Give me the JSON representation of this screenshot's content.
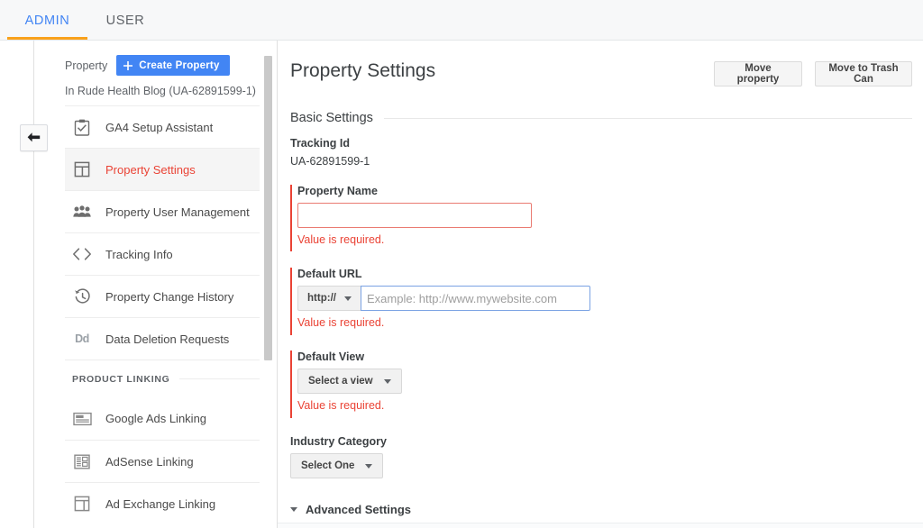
{
  "tabs": [
    {
      "label": "ADMIN",
      "active": true
    },
    {
      "label": "USER",
      "active": false
    }
  ],
  "rail": {
    "collapse_icon": "arrow-left-icon"
  },
  "sidebar": {
    "property_label": "Property",
    "create_button": "Create Property",
    "create_icon": "plus-icon",
    "property_name": "In Rude Health Blog (UA-62891599-1)",
    "items": [
      {
        "label": "GA4 Setup Assistant",
        "icon": "clipboard-check-icon",
        "active": false
      },
      {
        "label": "Property Settings",
        "icon": "layout-panel-icon",
        "active": true
      },
      {
        "label": "Property User Management",
        "icon": "people-group-icon",
        "active": false
      },
      {
        "label": "Tracking Info",
        "icon": "code-brackets-icon",
        "active": false
      },
      {
        "label": "Property Change History",
        "icon": "history-clock-icon",
        "active": false
      },
      {
        "label": "Data Deletion Requests",
        "icon": "dd-text-icon",
        "active": false
      }
    ],
    "section_title": "PRODUCT LINKING",
    "linking_items": [
      {
        "label": "Google Ads Linking",
        "icon": "ads-layout-icon"
      },
      {
        "label": "AdSense Linking",
        "icon": "adsense-layout-icon"
      },
      {
        "label": "Ad Exchange Linking",
        "icon": "adexchange-layout-icon"
      }
    ],
    "scrollbar": "vertical-scrollbar"
  },
  "main": {
    "title": "Property Settings",
    "move_property_button": "Move property",
    "move_trash_button": "Move to Trash Can",
    "section_basic": "Basic Settings",
    "tracking_id_label": "Tracking Id",
    "tracking_id_value": "UA-62891599-1",
    "property_name_label": "Property Name",
    "property_name_value": "",
    "property_name_error": "Value is required.",
    "default_url_label": "Default URL",
    "protocol_value": "http://",
    "url_placeholder": "Example: http://www.mywebsite.com",
    "url_value": "",
    "default_url_error": "Value is required.",
    "default_view_label": "Default View",
    "default_view_value": "Select a view",
    "default_view_error": "Value is required.",
    "industry_label": "Industry Category",
    "industry_value": "Select One",
    "advanced_label": "Advanced Settings",
    "advanced_caret": "caret-down-icon"
  },
  "colors": {
    "accent_blue": "#4285f4",
    "tab_underline": "#f9a11b",
    "error_red": "#ea4335",
    "focus_blue": "#7aa2e3"
  }
}
